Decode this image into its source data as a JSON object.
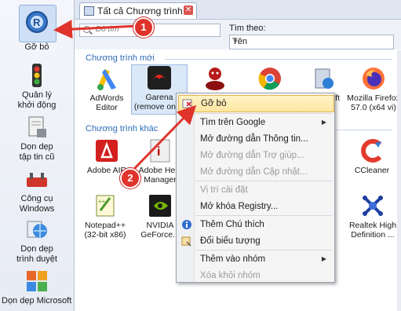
{
  "sidebar": {
    "items": [
      {
        "label": "Gỡ bỏ",
        "icon": "uninstall-icon"
      },
      {
        "label": "Quản lý khởi động",
        "icon": "traffic-light-icon"
      },
      {
        "label": "Dọn dẹp tập tin cũ",
        "icon": "file-cleanup-icon"
      },
      {
        "label": "Công cụ Windows",
        "icon": "windows-tools-icon"
      },
      {
        "label": "Dọn dẹp trình duyệt",
        "icon": "browser-cleanup-icon"
      },
      {
        "label": "Dọn dẹp Microsoft Offi",
        "icon": "office-cleanup-icon"
      }
    ]
  },
  "tab": {
    "label": "Tất cả Chương trình"
  },
  "search": {
    "placeholder": "Dò tìm",
    "findby_label": "Tìm theo:",
    "findby_value": "Tên"
  },
  "sections": {
    "new": "Chương trình mới",
    "other": "Chương trình khác"
  },
  "apps_new": [
    {
      "line1": "AdWords",
      "line2": "Editor"
    },
    {
      "line1": "Garena",
      "line2": "(remove only)"
    },
    {
      "line1": "",
      "line2": ""
    },
    {
      "line1": "",
      "line2": ""
    },
    {
      "line1": "ft",
      "line2": ""
    },
    {
      "line1": "Mozilla Firefox",
      "line2": "57.0 (x64 vi)"
    }
  ],
  "apps_other": [
    {
      "line1": "Adobe AIR",
      "line2": ""
    },
    {
      "line1": "Adobe Help",
      "line2": "Manager"
    },
    {
      "line1": "7",
      "line2": ""
    },
    {
      "line1": "CCleaner",
      "line2": ""
    },
    {
      "line1": "Notepad++",
      "line2": "(32-bit x86)"
    },
    {
      "line1": "NVIDIA",
      "line2": "GeForce..."
    },
    {
      "line1": "Realtek High",
      "line2": "Definition ..."
    }
  ],
  "menu": {
    "items": [
      {
        "label": "Gỡ bỏ"
      },
      {
        "label": "Tìm trên Google"
      },
      {
        "label": "Mở đường dẫn Thông tin..."
      },
      {
        "label": "Mở đường dẫn Trợ giúp..."
      },
      {
        "label": "Mở đường dẫn Cập nhật..."
      },
      {
        "label": "Vị trí cài đặt"
      },
      {
        "label": "Mở khóa Registry..."
      },
      {
        "label": "Thêm Chú thích"
      },
      {
        "label": "Đổi biểu tượng"
      },
      {
        "label": "Thêm vào nhóm"
      },
      {
        "label": "Xóa khỏi nhóm"
      }
    ]
  },
  "callouts": [
    "1",
    "2"
  ],
  "colors": {
    "accent": "#2d6cb8",
    "callout": "#e0332b",
    "highlight": "#fde6a0"
  }
}
